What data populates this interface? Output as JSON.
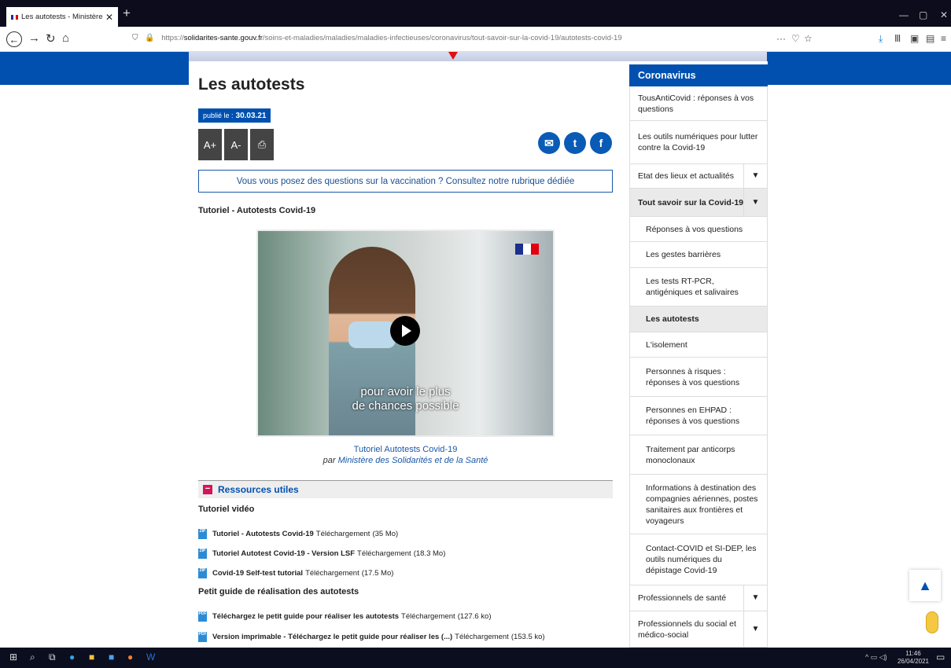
{
  "browser": {
    "tab_title": "Les autotests - Ministère des S",
    "tab_close": "✕",
    "new_tab": "+",
    "url_prefix": "https://",
    "url_domain": "solidarites-sante.gouv.fr",
    "url_path": "/soins-et-maladies/maladies/maladies-infectieuses/coronavirus/tout-savoir-sur-la-covid-19/autotests-covid-19",
    "more": "···"
  },
  "page": {
    "title": "Les autotests",
    "published_label": "publié le :",
    "published_date": "30.03.21",
    "font_increase": "A+",
    "font_decrease": "A-",
    "vaccination_notice": "Vous vous posez des questions sur la vaccination ? Consultez notre rubrique dédiée",
    "video_heading": "Tutoriel - Autotests Covid-19",
    "video_caption_line1": "pour avoir le plus",
    "video_caption_line2": "de chances possible",
    "video_title": "Tutoriel Autotests Covid-19",
    "video_by_prefix": "par",
    "video_by_author": "Ministère des Solidarités et de la Santé",
    "resources_title": "Ressources utiles",
    "resources_sections": [
      {
        "heading": "Tutoriel vidéo",
        "items": [
          {
            "type": "ZIP",
            "name": "Tutoriel - Autotests Covid-19",
            "action": "Téléchargement",
            "size": "(35 Mo)"
          },
          {
            "type": "ZIP",
            "name": "Tutoriel Autotest Covid-19 - Version LSF",
            "action": "Téléchargement",
            "size": "(18.3 Mo)"
          },
          {
            "type": "ZIP",
            "name": "Covid-19 Self-test tutorial",
            "action": "Téléchargement",
            "size": "(17.5 Mo)"
          }
        ]
      },
      {
        "heading": "Petit guide de réalisation des autotests",
        "items": [
          {
            "type": "PDF",
            "name": "Téléchargez le petit guide pour réaliser les autotests",
            "action": "Téléchargement",
            "size": "(127.6 ko)"
          },
          {
            "type": "PDF",
            "name": "Version imprimable - Téléchargez le petit guide pour réaliser les (...)",
            "action": "Téléchargement",
            "size": "(153.5 ko)"
          }
        ]
      }
    ]
  },
  "sidebar": {
    "title": "Coronavirus",
    "items": [
      {
        "label": "TousAntiCovid : réponses à vos questions"
      },
      {
        "label": "Les outils numériques pour lutter contre la Covid-19"
      },
      {
        "label": "Etat des lieux et actualités"
      },
      {
        "label": "Tout savoir sur la Covid-19"
      },
      {
        "label": "Réponses à vos questions"
      },
      {
        "label": "Les gestes barrières"
      },
      {
        "label": "Les tests RT-PCR, antigéniques et salivaires"
      },
      {
        "label": "Les autotests"
      },
      {
        "label": "L'isolement"
      },
      {
        "label": "Personnes à risques : réponses à vos questions"
      },
      {
        "label": "Personnes en EHPAD : réponses à vos questions"
      },
      {
        "label": "Traitement par anticorps monoclonaux"
      },
      {
        "label": "Informations à destination des compagnies aériennes, postes sanitaires aux frontières et voyageurs"
      },
      {
        "label": "Contact-COVID et SI-DEP, les outils numériques du dépistage Covid-19"
      },
      {
        "label": "Professionnels de santé"
      },
      {
        "label": "Professionnels du social et médico-social"
      }
    ]
  },
  "taskbar": {
    "time": "11:46",
    "date": "26/04/2021"
  },
  "colors": {
    "brand_blue": "#0150b0",
    "accent_pink": "#d4145a"
  }
}
